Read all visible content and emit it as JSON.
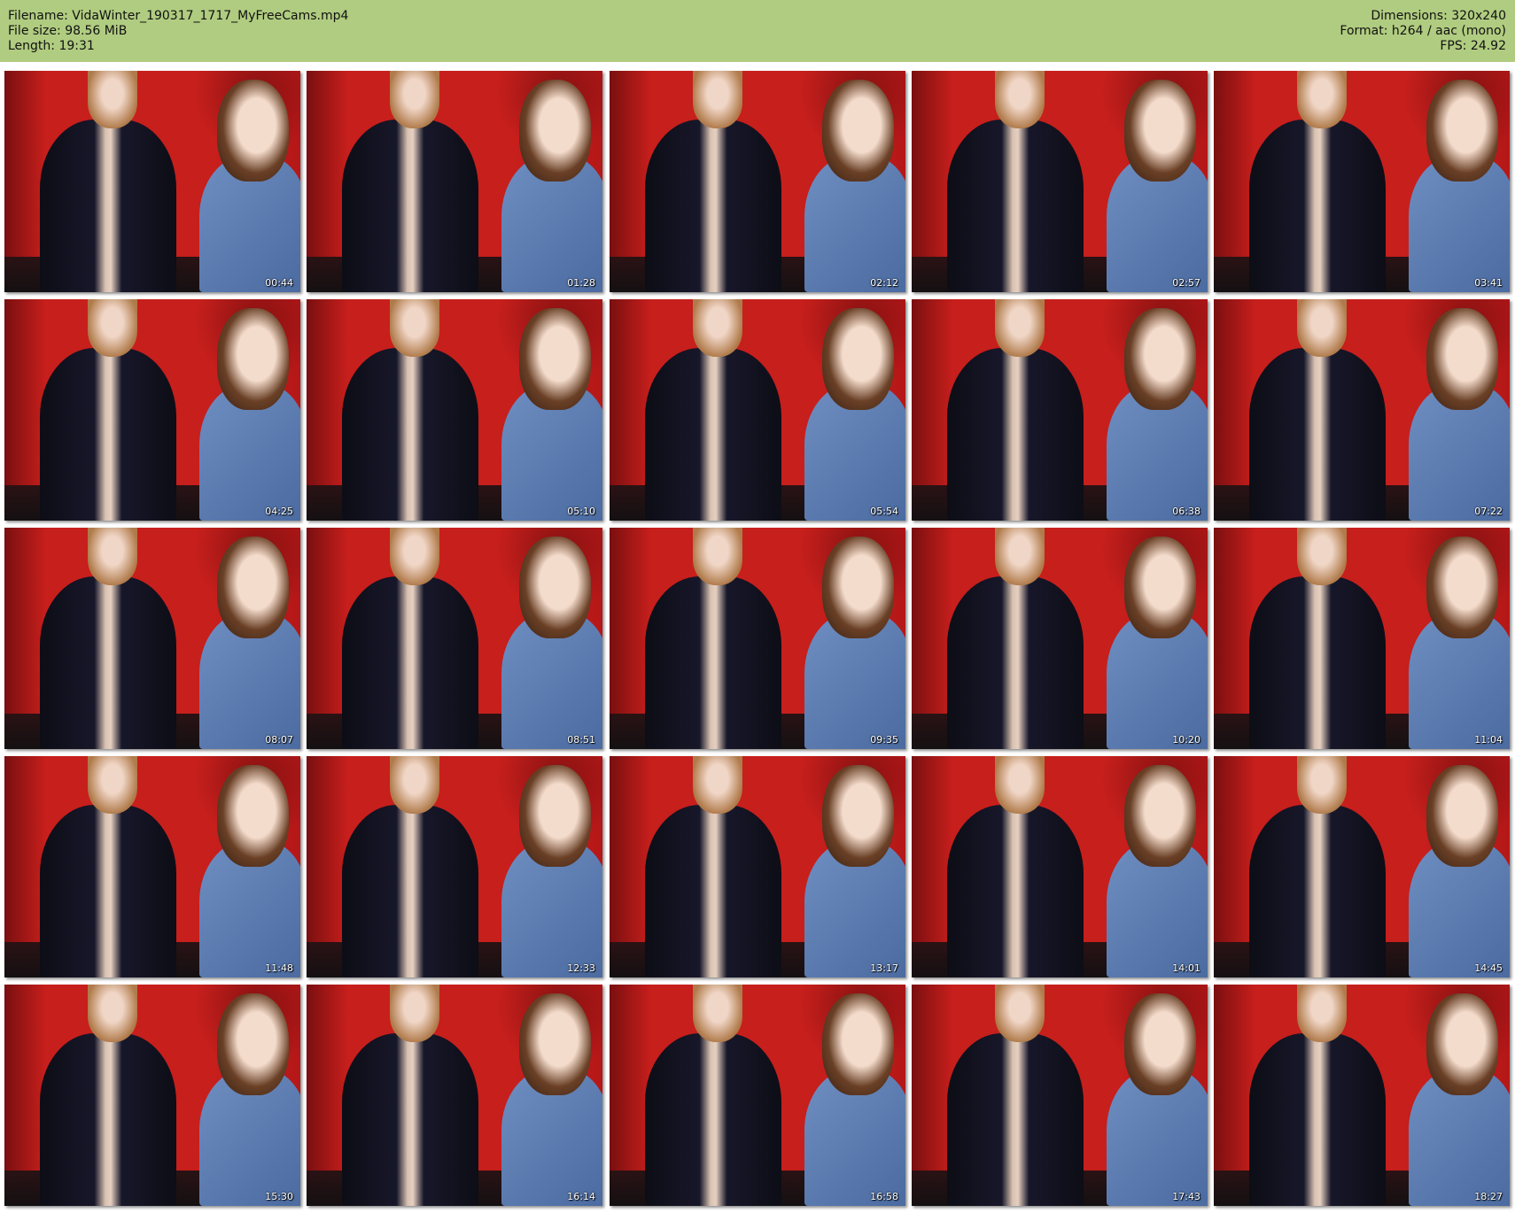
{
  "header": {
    "filename": "Filename: VidaWinter_190317_1717_MyFreeCams.mp4",
    "file_size": "File size: 98.56 MiB",
    "length": "Length: 19:31",
    "dimensions": "Dimensions: 320x240",
    "format": "Format: h264 / aac (mono)",
    "fps": "FPS: 24.92",
    "background_color": "#b0cc80"
  },
  "thumbnails": [
    "00:44",
    "01:28",
    "02:12",
    "02:57",
    "03:41",
    "04:25",
    "05:10",
    "05:54",
    "06:38",
    "07:22",
    "08:07",
    "08:51",
    "09:35",
    "10:20",
    "11:04",
    "11:48",
    "12:33",
    "13:17",
    "14:01",
    "14:45",
    "15:30",
    "16:14",
    "16:58",
    "17:43",
    "18:27"
  ]
}
